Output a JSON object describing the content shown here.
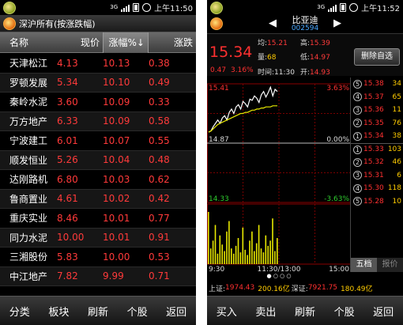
{
  "left": {
    "status": {
      "signal": "3G",
      "time": "上午11:50"
    },
    "title": "深沪所有(按涨跌幅)",
    "columns": {
      "name": "名称",
      "price": "现价",
      "change_pct": "涨幅%↓",
      "change": "涨跌"
    },
    "rows": [
      {
        "name": "天津松江",
        "price": "4.13",
        "pct": "10.13",
        "chg": "0.38"
      },
      {
        "name": "罗顿发展",
        "price": "5.34",
        "pct": "10.10",
        "chg": "0.49"
      },
      {
        "name": "秦岭水泥",
        "price": "3.60",
        "pct": "10.09",
        "chg": "0.33"
      },
      {
        "name": "万方地产",
        "price": "6.33",
        "pct": "10.09",
        "chg": "0.58"
      },
      {
        "name": "宁波建工",
        "price": "6.01",
        "pct": "10.07",
        "chg": "0.55"
      },
      {
        "name": "顺发恒业",
        "price": "5.26",
        "pct": "10.04",
        "chg": "0.48"
      },
      {
        "name": "达刚路机",
        "price": "6.80",
        "pct": "10.03",
        "chg": "0.62"
      },
      {
        "name": "鲁商置业",
        "price": "4.61",
        "pct": "10.02",
        "chg": "0.42"
      },
      {
        "name": "重庆实业",
        "price": "8.46",
        "pct": "10.01",
        "chg": "0.77"
      },
      {
        "name": "同力水泥",
        "price": "10.00",
        "pct": "10.01",
        "chg": "0.91"
      },
      {
        "name": "三湘股份",
        "price": "5.83",
        "pct": "10.00",
        "chg": "0.53"
      },
      {
        "name": "中江地产",
        "price": "7.82",
        "pct": "9.99",
        "chg": "0.71"
      }
    ],
    "toolbar": [
      "分类",
      "板块",
      "刷新",
      "个股",
      "返回"
    ]
  },
  "right": {
    "status": {
      "signal": "3G",
      "time": "上午11:52"
    },
    "stock": {
      "name": "比亚迪",
      "code": "002594"
    },
    "quote": {
      "price": "15.34",
      "change": "0.47",
      "pct": "3.16%",
      "time": "时间:11:30",
      "avg_label": "均:",
      "avg": "15.21",
      "vol_label": "量:",
      "vol": "68",
      "high_label": "高:",
      "high": "15.39",
      "low_label": "低:",
      "low": "14.97",
      "open_label": "开:",
      "open": "14.93"
    },
    "delete_button": "删除自选",
    "chart_labels": {
      "top_price": "15.41",
      "top_pct": "3.63%",
      "mid_price": "14.87",
      "mid_pct": "0.00%",
      "bot_price": "14.33",
      "bot_pct": "-3.63%",
      "t_start": "9:30",
      "t_mid": "11:30/13:00",
      "t_end": "15:00"
    },
    "book": [
      {
        "level": "5",
        "price": "15.38",
        "vol": "34"
      },
      {
        "level": "4",
        "price": "15.37",
        "vol": "65"
      },
      {
        "level": "3",
        "price": "15.36",
        "vol": "11"
      },
      {
        "level": "2",
        "price": "15.35",
        "vol": "76"
      },
      {
        "level": "1",
        "price": "15.34",
        "vol": "38"
      },
      {
        "level": "1",
        "price": "15.33",
        "vol": "103"
      },
      {
        "level": "2",
        "price": "15.32",
        "vol": "46"
      },
      {
        "level": "3",
        "price": "15.31",
        "vol": "6"
      },
      {
        "level": "4",
        "price": "15.30",
        "vol": "118"
      },
      {
        "level": "5",
        "price": "15.28",
        "vol": "10"
      }
    ],
    "book_tabs": {
      "five": "五档",
      "detail": "报价"
    },
    "index_bar": {
      "sh_label": "上证:",
      "sh_value": "1974.43",
      "sh_amount": "200.16亿",
      "sz_label": "深证:",
      "sz_value": "7921.75",
      "sz_amount": "180.49亿"
    },
    "toolbar": [
      "买入",
      "卖出",
      "刷新",
      "个股",
      "返回"
    ],
    "chart_data": {
      "type": "line",
      "title": "",
      "xlabel": "",
      "ylabel": "",
      "x_ticks": [
        "9:30",
        "11:30/13:00",
        "15:00"
      ],
      "ylim": [
        14.33,
        15.41
      ],
      "prev_close": 14.87,
      "series": [
        {
          "values": [
            14.97,
            14.98,
            15.02,
            15.05,
            15.08,
            15.05,
            15.1,
            15.12,
            15.08,
            15.15,
            15.18,
            15.14,
            15.2,
            15.22,
            15.18,
            15.25,
            15.23,
            15.2,
            15.27,
            15.26,
            15.3,
            15.28,
            15.24,
            15.31,
            15.34,
            15.29,
            15.33,
            15.38,
            15.3,
            15.36,
            15.34
          ]
        },
        {
          "values": [
            14.97,
            14.98,
            15.0,
            15.02,
            15.04,
            15.05,
            15.06,
            15.07,
            15.08,
            15.09,
            15.1,
            15.11,
            15.12,
            15.13,
            15.14,
            15.14,
            15.15,
            15.15,
            15.16,
            15.17,
            15.17,
            15.18,
            15.18,
            15.19,
            15.19,
            15.2,
            15.2,
            15.2,
            15.21,
            15.21,
            15.21
          ]
        }
      ],
      "volume": [
        40,
        12,
        18,
        30,
        8,
        22,
        15,
        10,
        25,
        33,
        12,
        8,
        14,
        20,
        9,
        28,
        11,
        7,
        18,
        25,
        10,
        16,
        30,
        12,
        9,
        22,
        14,
        18,
        35,
        10,
        20
      ]
    }
  }
}
